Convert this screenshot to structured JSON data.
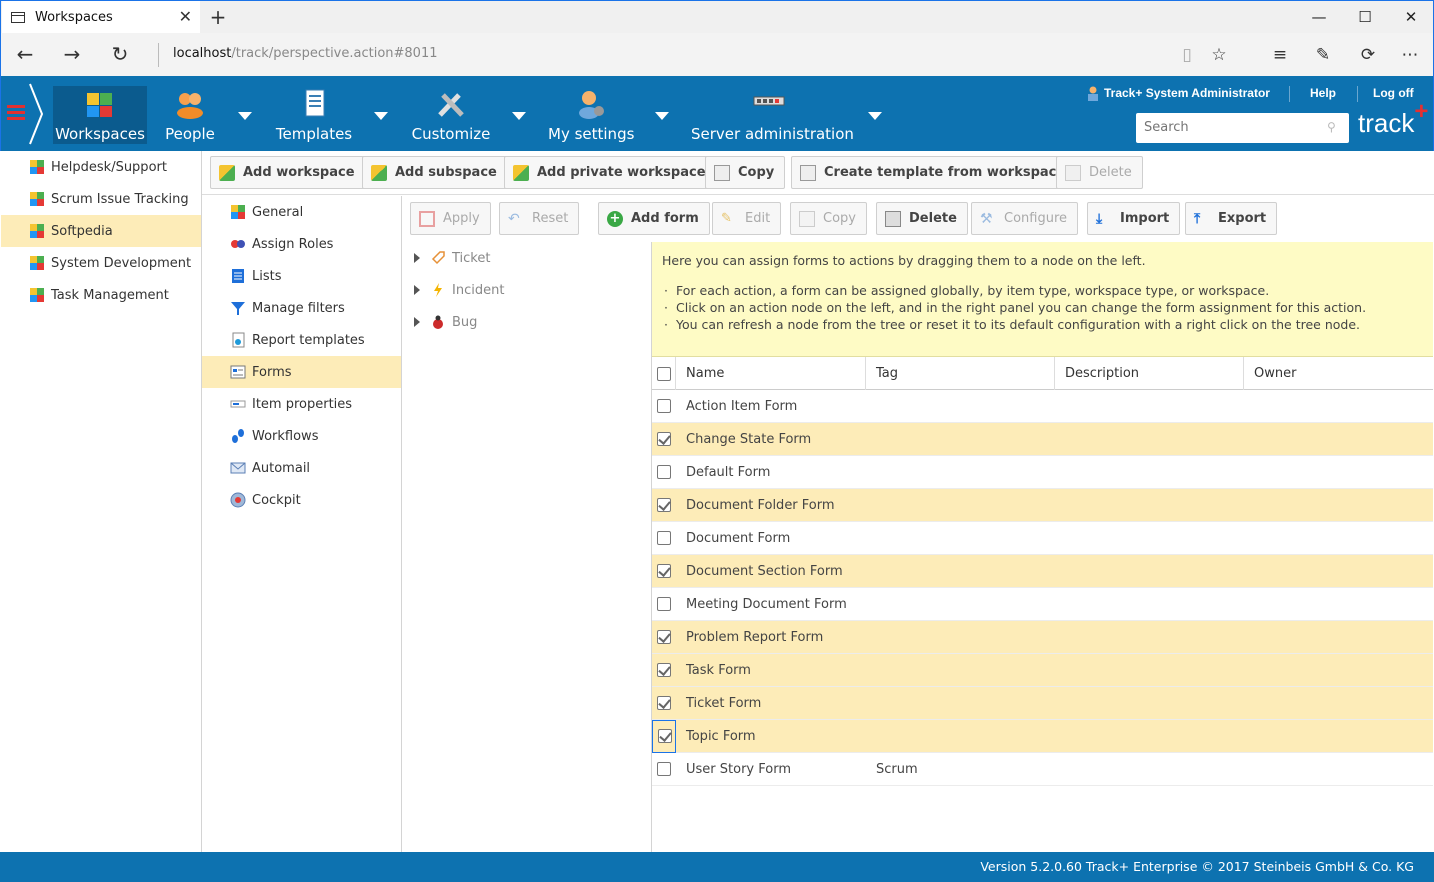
{
  "browser": {
    "tab_title": "Workspaces",
    "url_host": "localhost",
    "url_path": "/track/perspective.action#8011",
    "tab_close": "✕",
    "new_tab": "+",
    "minimize": "—",
    "maximize": "☐",
    "close": "✕"
  },
  "header": {
    "nav": [
      {
        "label": "Workspaces"
      },
      {
        "label": "People"
      },
      {
        "label": "Templates"
      },
      {
        "label": "Customize"
      },
      {
        "label": "My settings"
      },
      {
        "label": "Server administration"
      }
    ],
    "user": "Track+ System Administrator",
    "help": "Help",
    "logoff": "Log off",
    "search_placeholder": "Search",
    "brand": "track",
    "brand_plus": "+"
  },
  "workspaces": [
    {
      "label": "Helpdesk/Support"
    },
    {
      "label": "Scrum Issue Tracking"
    },
    {
      "label": "Softpedia"
    },
    {
      "label": "System Development"
    },
    {
      "label": "Task Management"
    }
  ],
  "toolbar1": {
    "add_workspace": "Add workspace",
    "add_subspace": "Add subspace",
    "add_private": "Add private workspace",
    "copy": "Copy",
    "create_template": "Create template from workspace",
    "delete": "Delete"
  },
  "config_nav": [
    {
      "label": "General"
    },
    {
      "label": "Assign Roles"
    },
    {
      "label": "Lists"
    },
    {
      "label": "Manage filters"
    },
    {
      "label": "Report templates"
    },
    {
      "label": "Forms"
    },
    {
      "label": "Item properties"
    },
    {
      "label": "Workflows"
    },
    {
      "label": "Automail"
    },
    {
      "label": "Cockpit"
    }
  ],
  "toolbar2": {
    "apply": "Apply",
    "reset": "Reset",
    "add_form": "Add form",
    "edit": "Edit",
    "copy": "Copy",
    "delete": "Delete",
    "configure": "Configure",
    "import": "Import",
    "export": "Export"
  },
  "tree": [
    {
      "label": "Ticket"
    },
    {
      "label": "Incident"
    },
    {
      "label": "Bug"
    }
  ],
  "info": {
    "intro": "Here you can assign forms to actions by dragging them to a node on the left.",
    "bullets": [
      "For each action, a form can be assigned globally, by item type, workspace type, or workspace.",
      "Click on an action node on the left, and in the right panel you can change the form assignment for this action.",
      "You can refresh a node from the tree or reset it to its default configuration with a right click on the tree node."
    ]
  },
  "grid": {
    "columns": {
      "name": "Name",
      "tag": "Tag",
      "description": "Description",
      "owner": "Owner"
    },
    "rows": [
      {
        "name": "Action Item Form",
        "tag": "",
        "checked": false
      },
      {
        "name": "Change State Form",
        "tag": "",
        "checked": true
      },
      {
        "name": "Default Form",
        "tag": "",
        "checked": false
      },
      {
        "name": "Document Folder Form",
        "tag": "",
        "checked": true
      },
      {
        "name": "Document Form",
        "tag": "",
        "checked": false
      },
      {
        "name": "Document Section Form",
        "tag": "",
        "checked": true
      },
      {
        "name": "Meeting Document Form",
        "tag": "",
        "checked": false
      },
      {
        "name": "Problem Report Form",
        "tag": "",
        "checked": true
      },
      {
        "name": "Task Form",
        "tag": "",
        "checked": true
      },
      {
        "name": "Ticket Form",
        "tag": "",
        "checked": true
      },
      {
        "name": "Topic Form",
        "tag": "",
        "checked": true
      },
      {
        "name": "User Story Form",
        "tag": "Scrum",
        "checked": false
      }
    ]
  },
  "footer": "Version 5.2.0.60 Track+ Enterprise   © 2017 Steinbeis GmbH & Co. KG",
  "colors": {
    "header_bg": "#0d72b0",
    "selection": "#fdecb8",
    "info_bg": "#fefbc5"
  }
}
